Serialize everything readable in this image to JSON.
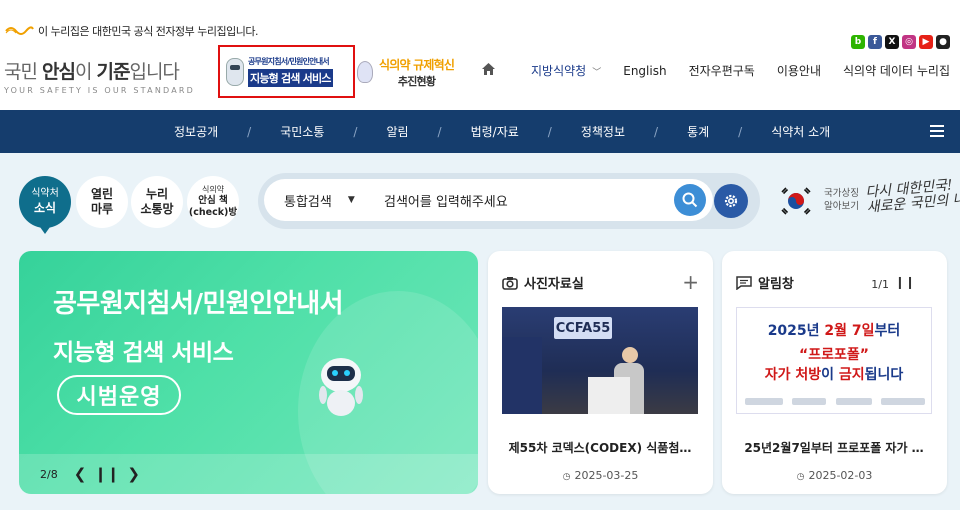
{
  "gov_notice": "이 누리집은 대한민국 공식 전자정부 누리집입니다.",
  "logo": {
    "main_a": "국민 ",
    "main_b": "안심",
    "main_c": "이 ",
    "main_d": "기준",
    "main_e": "입니다",
    "sub": "YOUR SAFETY IS OUR STANDARD"
  },
  "banner1": {
    "line1": "공무원지침서/민원인안내서",
    "line2": "지능형 검색 서비스"
  },
  "banner2": {
    "line1": "식의약 규제혁신",
    "line2": "추진현황"
  },
  "social": [
    {
      "name": "blog-icon",
      "glyph": "b",
      "color": "#2db400"
    },
    {
      "name": "facebook-icon",
      "glyph": "f",
      "color": "#3b5998"
    },
    {
      "name": "x-icon",
      "glyph": "X",
      "color": "#111111"
    },
    {
      "name": "instagram-icon",
      "glyph": "◎",
      "color": "#c13584"
    },
    {
      "name": "youtube-icon",
      "glyph": "▶",
      "color": "#e62117"
    },
    {
      "name": "kakao-icon",
      "glyph": "●",
      "color": "#222222"
    }
  ],
  "util_menu": {
    "regional": "지방식약청",
    "english": "English",
    "subscribe": "전자우편구독",
    "guide": "이용안내",
    "data_portal": "식의약 데이터 누리집"
  },
  "nav": [
    "정보공개",
    "국민소통",
    "알림",
    "법령/자료",
    "정책정보",
    "통계",
    "식약처 소개"
  ],
  "quick": [
    {
      "t1": "식약처",
      "t2": "소식"
    },
    {
      "t1": "열린",
      "t2": "마루"
    },
    {
      "t1": "누리",
      "t2": "소통망"
    },
    {
      "t1": "식의약",
      "t2a": "안심 책",
      "t2b": "(check)방"
    }
  ],
  "search": {
    "category": "통합검색",
    "placeholder": "검색어를 입력해주세요"
  },
  "national_symbol": {
    "line1": "국가상징",
    "line2": "알아보기",
    "slogan1": "다시 대한민국!",
    "slogan2": "새로운 국민의 나라"
  },
  "hero": {
    "line1": "공무원지침서/민원인안내서",
    "line2": "지능형 검색 서비스",
    "pill": "시범운영",
    "page": "2/8"
  },
  "photo_card": {
    "title": "사진자료실",
    "plus": "+",
    "caption": "제55차 코덱스(CODEX) 식품첨…",
    "date": "2025-03-25",
    "screen_text": "CCFA55"
  },
  "notice_card": {
    "title": "알림창",
    "page": "1/1",
    "caption": "25년2월7일부터 프로포폴 자가 …",
    "date": "2025-02-03",
    "img_line1_a": "2025년 ",
    "img_line1_b": "2월 7일",
    "img_line1_c": "부터",
    "img_line2": "“프로포폴”",
    "img_line3_a": "자가 처방",
    "img_line3_b": "이 ",
    "img_line3_c": "금지",
    "img_line3_d": "됩니다"
  }
}
